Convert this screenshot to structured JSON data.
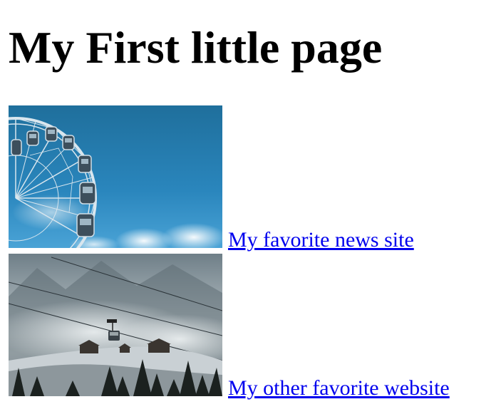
{
  "page": {
    "title": "My First little page"
  },
  "links": [
    {
      "label": "My favorite news site",
      "image": "ferris-wheel-blue-sky",
      "color": "#0000ee"
    },
    {
      "label": "My other favorite website",
      "image": "cable-car-snowy-mountains",
      "color": "#0000ee"
    }
  ]
}
